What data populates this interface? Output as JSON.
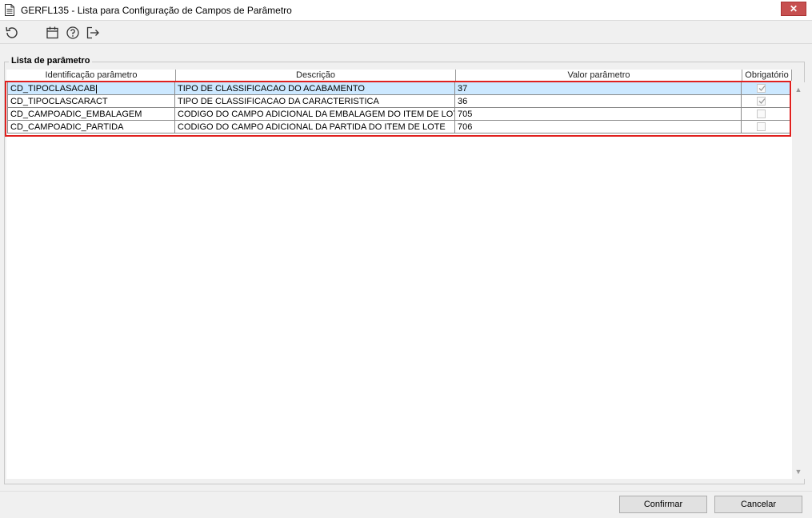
{
  "window": {
    "title": "GERFL135 - Lista para Configuração de Campos de Parâmetro",
    "close_label": "✕"
  },
  "toolbar": {
    "buttons": [
      {
        "name": "refresh-icon"
      },
      {
        "name": "calendar-icon"
      },
      {
        "name": "help-icon"
      },
      {
        "name": "exit-icon"
      }
    ]
  },
  "group": {
    "legend": "Lista de parâmetro"
  },
  "table": {
    "columns": [
      "Identificação parâmetro",
      "Descrição",
      "Valor parâmetro",
      "Obrigatório"
    ],
    "rows": [
      {
        "id": "CD_TIPOCLASACAB",
        "desc": "TIPO DE CLASSIFICACAO DO ACABAMENTO",
        "value": "37",
        "required": true,
        "selected": true
      },
      {
        "id": "CD_TIPOCLASCARACT",
        "desc": "TIPO DE CLASSIFICACAO DA CARACTERISTICA",
        "value": "36",
        "required": true,
        "selected": false
      },
      {
        "id": "CD_CAMPOADIC_EMBALAGEM",
        "desc": "CODIGO DO CAMPO ADICIONAL DA EMBALAGEM DO ITEM DE LOTE",
        "value": "705",
        "required": false,
        "selected": false
      },
      {
        "id": "CD_CAMPOADIC_PARTIDA",
        "desc": "CODIGO DO CAMPO ADICIONAL DA PARTIDA DO ITEM DE LOTE",
        "value": "706",
        "required": false,
        "selected": false
      }
    ]
  },
  "actions": {
    "confirm_label": "Confirmar",
    "cancel_label": "Cancelar"
  },
  "colors": {
    "selection": "#cce8ff",
    "highlight": "#e0201e",
    "close": "#c75050"
  }
}
